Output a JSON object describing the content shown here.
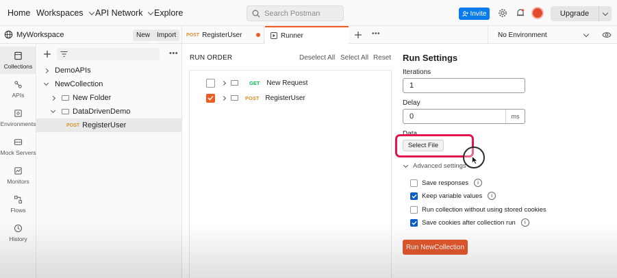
{
  "topnav": {
    "home": "Home",
    "workspaces": "Workspaces",
    "api_network": "API Network",
    "explore": "Explore",
    "search_placeholder": "Search Postman",
    "invite": "Invite",
    "upgrade": "Upgrade"
  },
  "workspace": {
    "name": "MyWorkspace",
    "new_label": "New",
    "import_label": "Import"
  },
  "sidebar": {
    "items": [
      {
        "label": "Collections"
      },
      {
        "label": "APIs"
      },
      {
        "label": "Environments"
      },
      {
        "label": "Mock Servers"
      },
      {
        "label": "Monitors"
      },
      {
        "label": "Flows"
      },
      {
        "label": "History"
      }
    ]
  },
  "tree": {
    "rows": [
      {
        "label": "DemoAPIs"
      },
      {
        "label": "NewCollection"
      },
      {
        "label": "New Folder"
      },
      {
        "label": "DataDrivenDemo"
      },
      {
        "method": "POST",
        "label": "RegisterUser"
      }
    ]
  },
  "tabs": {
    "items": [
      {
        "method": "POST",
        "label": "RegisterUser"
      },
      {
        "label": "Runner"
      }
    ],
    "environment": "No Environment"
  },
  "run_order": {
    "title": "RUN ORDER",
    "deselect_all": "Deselect All",
    "select_all": "Select All",
    "reset": "Reset",
    "requests": [
      {
        "method": "GET",
        "name": "New Request",
        "checked": false
      },
      {
        "method": "POST",
        "name": "RegisterUser",
        "checked": true
      }
    ]
  },
  "run_settings": {
    "title": "Run Settings",
    "iterations_label": "Iterations",
    "iterations_value": "1",
    "delay_label": "Delay",
    "delay_value": "0",
    "delay_unit": "ms",
    "data_label": "Data",
    "select_file": "Select File",
    "advanced_label": "Advanced settings",
    "options": [
      {
        "label": "Save responses",
        "checked": false
      },
      {
        "label": "Keep variable values",
        "checked": true
      },
      {
        "label": "Run collection without using stored cookies",
        "checked": false
      },
      {
        "label": "Save cookies after collection run",
        "checked": true
      }
    ],
    "run_button": "Run NewCollection"
  },
  "colors": {
    "accent_orange": "#ef5b25",
    "invite_blue": "#097bed",
    "check_blue": "#0a5cc7",
    "highlight_red": "#e2134e"
  }
}
